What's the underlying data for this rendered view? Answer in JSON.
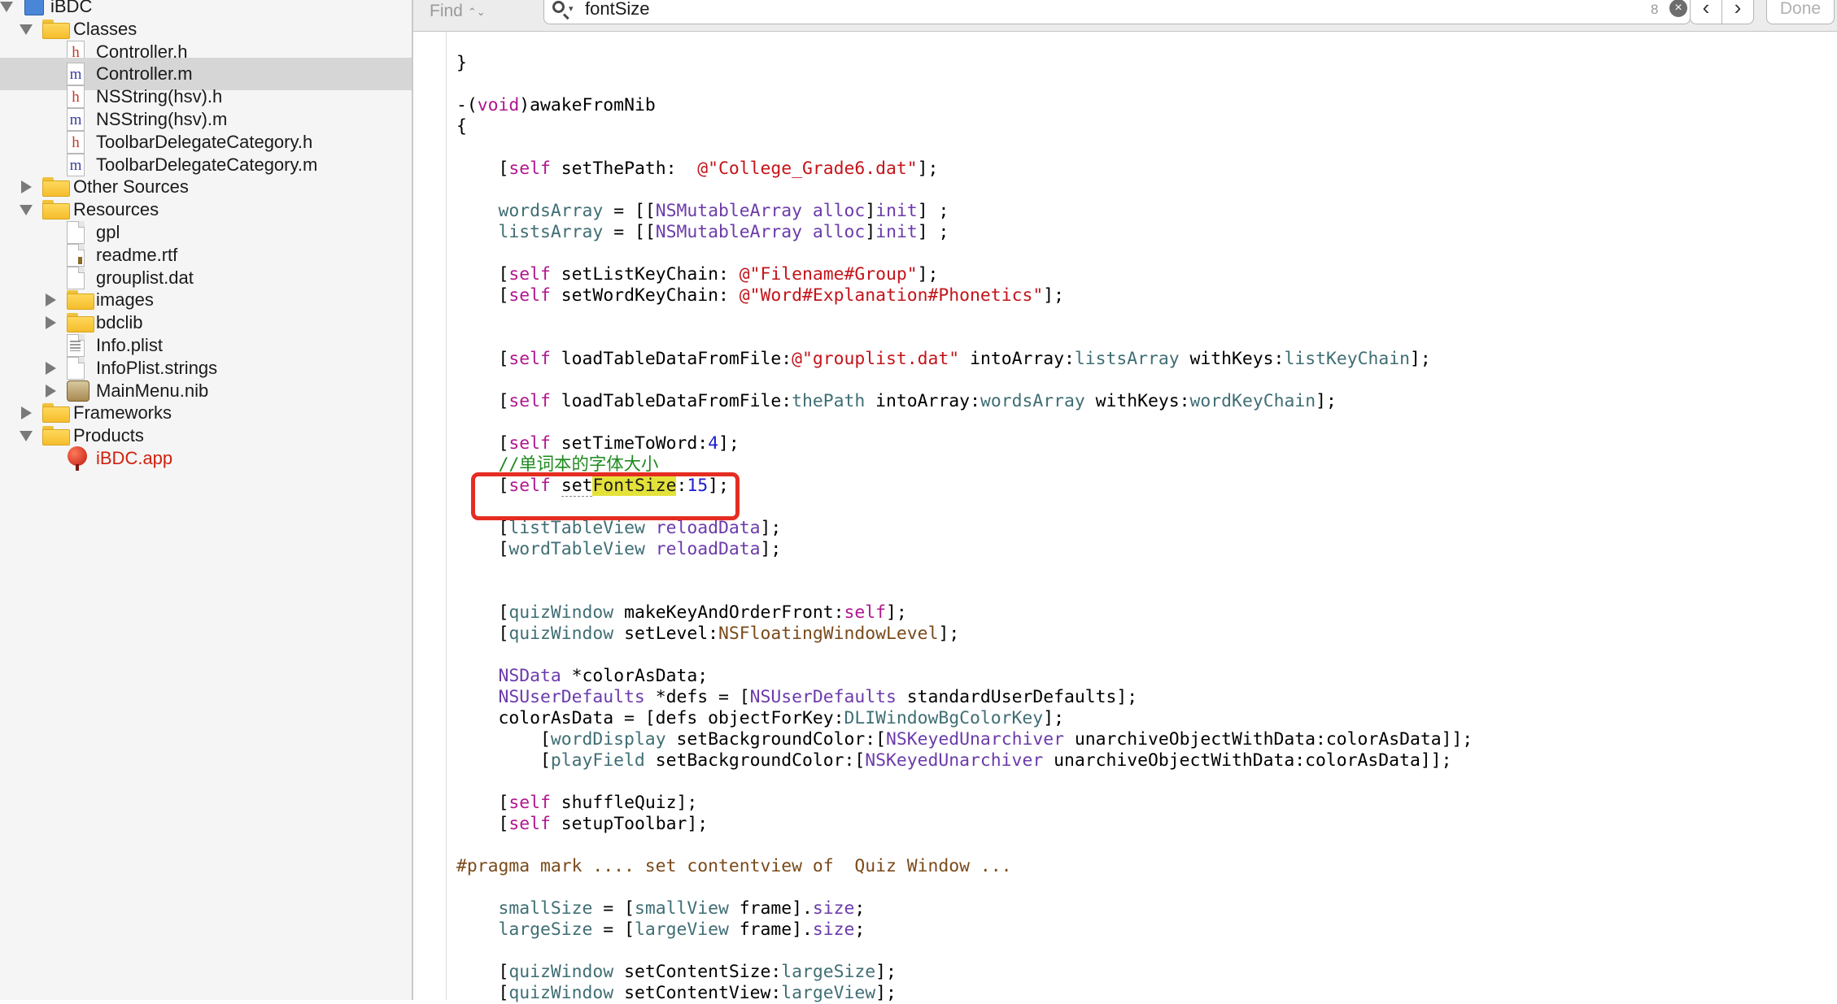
{
  "sidebar": {
    "items": [
      {
        "label": "iBDC",
        "kind": "project",
        "depth": 0,
        "disclosure": "open"
      },
      {
        "label": "Classes",
        "kind": "folder",
        "depth": 1,
        "disclosure": "open"
      },
      {
        "label": "Controller.h",
        "kind": "file-h",
        "depth": 2,
        "disclosure": "none"
      },
      {
        "label": "Controller.m",
        "kind": "file-m",
        "depth": 2,
        "disclosure": "none",
        "selected": true
      },
      {
        "label": "NSString(hsv).h",
        "kind": "file-h",
        "depth": 2,
        "disclosure": "none"
      },
      {
        "label": "NSString(hsv).m",
        "kind": "file-m",
        "depth": 2,
        "disclosure": "none"
      },
      {
        "label": "ToolbarDelegateCategory.h",
        "kind": "file-h",
        "depth": 2,
        "disclosure": "none"
      },
      {
        "label": "ToolbarDelegateCategory.m",
        "kind": "file-m",
        "depth": 2,
        "disclosure": "none"
      },
      {
        "label": "Other Sources",
        "kind": "folder",
        "depth": 1,
        "disclosure": "closed"
      },
      {
        "label": "Resources",
        "kind": "folder",
        "depth": 1,
        "disclosure": "open"
      },
      {
        "label": "gpl",
        "kind": "file-plain",
        "depth": 2,
        "disclosure": "none"
      },
      {
        "label": "readme.rtf",
        "kind": "file-rtf",
        "depth": 2,
        "disclosure": "none"
      },
      {
        "label": "grouplist.dat",
        "kind": "file-plain",
        "depth": 2,
        "disclosure": "none"
      },
      {
        "label": "images",
        "kind": "folder",
        "depth": 2,
        "disclosure": "closed"
      },
      {
        "label": "bdclib",
        "kind": "folder",
        "depth": 2,
        "disclosure": "closed"
      },
      {
        "label": "Info.plist",
        "kind": "file-plist",
        "depth": 2,
        "disclosure": "none"
      },
      {
        "label": "InfoPlist.strings",
        "kind": "file-plain",
        "depth": 2,
        "disclosure": "closed"
      },
      {
        "label": "MainMenu.nib",
        "kind": "nib",
        "depth": 2,
        "disclosure": "closed"
      },
      {
        "label": "Frameworks",
        "kind": "folder",
        "depth": 1,
        "disclosure": "closed"
      },
      {
        "label": "Products",
        "kind": "folder",
        "depth": 1,
        "disclosure": "open"
      },
      {
        "label": "iBDC.app",
        "kind": "app",
        "depth": 2,
        "disclosure": "none"
      }
    ]
  },
  "findbar": {
    "mode_label": "Find",
    "mode_arrows": "⌃⌄",
    "query": "fontSize",
    "match_count": "8",
    "clear_glyph": "×",
    "prev_glyph": "‹",
    "next_glyph": "›",
    "done_label": "Done"
  },
  "editor": {
    "file": "Controller.m",
    "highlight_color": "#e52d22",
    "find_match_color": "#e4e23a",
    "lines": [
      [
        {
          "t": "}"
        }
      ],
      [],
      [
        {
          "t": "-("
        },
        {
          "t": "void",
          "c": "kw"
        },
        {
          "t": ")awakeFromNib"
        }
      ],
      [
        {
          "t": "{"
        }
      ],
      [],
      [
        {
          "t": "    ["
        },
        {
          "t": "self",
          "c": "kw"
        },
        {
          "t": " setThePath:  "
        },
        {
          "t": "@\"College_Grade6.dat\"",
          "c": "str"
        },
        {
          "t": "];"
        }
      ],
      [],
      [
        {
          "t": "    "
        },
        {
          "t": "wordsArray",
          "c": "ivar"
        },
        {
          "t": " = [["
        },
        {
          "t": "NSMutableArray",
          "c": "cls"
        },
        {
          "t": " "
        },
        {
          "t": "alloc",
          "c": "cls"
        },
        {
          "t": "]"
        },
        {
          "t": "init",
          "c": "cls"
        },
        {
          "t": "] ;"
        }
      ],
      [
        {
          "t": "    "
        },
        {
          "t": "listsArray",
          "c": "ivar"
        },
        {
          "t": " = [["
        },
        {
          "t": "NSMutableArray",
          "c": "cls"
        },
        {
          "t": " "
        },
        {
          "t": "alloc",
          "c": "cls"
        },
        {
          "t": "]"
        },
        {
          "t": "init",
          "c": "cls"
        },
        {
          "t": "] ;"
        }
      ],
      [],
      [
        {
          "t": "    ["
        },
        {
          "t": "self",
          "c": "kw"
        },
        {
          "t": " setListKeyChain: "
        },
        {
          "t": "@\"Filename#Group\"",
          "c": "str"
        },
        {
          "t": "];"
        }
      ],
      [
        {
          "t": "    ["
        },
        {
          "t": "self",
          "c": "kw"
        },
        {
          "t": " setWordKeyChain: "
        },
        {
          "t": "@\"Word#Explanation#Phonetics\"",
          "c": "str"
        },
        {
          "t": "];"
        }
      ],
      [],
      [],
      [
        {
          "t": "    ["
        },
        {
          "t": "self",
          "c": "kw"
        },
        {
          "t": " loadTableDataFromFile:"
        },
        {
          "t": "@\"grouplist.dat\"",
          "c": "str"
        },
        {
          "t": " intoArray:"
        },
        {
          "t": "listsArray",
          "c": "ivar"
        },
        {
          "t": " withKeys:"
        },
        {
          "t": "listKeyChain",
          "c": "ivar"
        },
        {
          "t": "];"
        }
      ],
      [],
      [
        {
          "t": "    ["
        },
        {
          "t": "self",
          "c": "kw"
        },
        {
          "t": " loadTableDataFromFile:"
        },
        {
          "t": "thePath",
          "c": "ivar"
        },
        {
          "t": " intoArray:"
        },
        {
          "t": "wordsArray",
          "c": "ivar"
        },
        {
          "t": " withKeys:"
        },
        {
          "t": "wordKeyChain",
          "c": "ivar"
        },
        {
          "t": "];"
        }
      ],
      [],
      [
        {
          "t": "    ["
        },
        {
          "t": "self",
          "c": "kw"
        },
        {
          "t": " setTimeToWord:"
        },
        {
          "t": "4",
          "c": "num"
        },
        {
          "t": "];"
        }
      ],
      [
        {
          "t": "    "
        },
        {
          "t": "//单词本的字体大小",
          "c": "cmt"
        }
      ],
      [
        {
          "t": "    ["
        },
        {
          "t": "self",
          "c": "kw"
        },
        {
          "t": " "
        },
        {
          "t": "set",
          "c": "cursor-dash"
        },
        {
          "t": "FontSize",
          "c": "fmatch"
        },
        {
          "t": ":"
        },
        {
          "t": "15",
          "c": "num"
        },
        {
          "t": "];"
        }
      ],
      [],
      [
        {
          "t": "    ["
        },
        {
          "t": "listTableView",
          "c": "ivar"
        },
        {
          "t": " "
        },
        {
          "t": "reloadData",
          "c": "cls"
        },
        {
          "t": "];"
        }
      ],
      [
        {
          "t": "    ["
        },
        {
          "t": "wordTableView",
          "c": "ivar"
        },
        {
          "t": " "
        },
        {
          "t": "reloadData",
          "c": "cls"
        },
        {
          "t": "];"
        }
      ],
      [],
      [],
      [
        {
          "t": "    ["
        },
        {
          "t": "quizWindow",
          "c": "ivar"
        },
        {
          "t": " makeKeyAndOrderFront:"
        },
        {
          "t": "self",
          "c": "kw"
        },
        {
          "t": "];"
        }
      ],
      [
        {
          "t": "    ["
        },
        {
          "t": "quizWindow",
          "c": "ivar"
        },
        {
          "t": " setLevel:"
        },
        {
          "t": "NSFloatingWindowLevel",
          "c": "pre"
        },
        {
          "t": "];"
        }
      ],
      [],
      [
        {
          "t": "    "
        },
        {
          "t": "NSData",
          "c": "cls"
        },
        {
          "t": " *colorAsData;"
        }
      ],
      [
        {
          "t": "    "
        },
        {
          "t": "NSUserDefaults",
          "c": "cls"
        },
        {
          "t": " *defs = ["
        },
        {
          "t": "NSUserDefaults",
          "c": "cls"
        },
        {
          "t": " standardUserDefaults];"
        }
      ],
      [
        {
          "t": "    colorAsData = [defs objectForKey:"
        },
        {
          "t": "DLIWindowBgColorKey",
          "c": "ivar"
        },
        {
          "t": "];"
        }
      ],
      [
        {
          "t": "        ["
        },
        {
          "t": "wordDisplay",
          "c": "ivar"
        },
        {
          "t": " setBackgroundColor:["
        },
        {
          "t": "NSKeyedUnarchiver",
          "c": "cls"
        },
        {
          "t": " unarchiveObjectWithData:colorAsData]];"
        }
      ],
      [
        {
          "t": "        ["
        },
        {
          "t": "playField",
          "c": "ivar"
        },
        {
          "t": " setBackgroundColor:["
        },
        {
          "t": "NSKeyedUnarchiver",
          "c": "cls"
        },
        {
          "t": " unarchiveObjectWithData:colorAsData]];"
        }
      ],
      [],
      [
        {
          "t": "    ["
        },
        {
          "t": "self",
          "c": "kw"
        },
        {
          "t": " shuffleQuiz];"
        }
      ],
      [
        {
          "t": "    ["
        },
        {
          "t": "self",
          "c": "kw"
        },
        {
          "t": " setupToolbar];"
        }
      ],
      [],
      [
        {
          "t": "#pragma mark .... set contentview of  Quiz Window ...",
          "c": "pre"
        }
      ],
      [],
      [
        {
          "t": "    "
        },
        {
          "t": "smallSize",
          "c": "ivar"
        },
        {
          "t": " = ["
        },
        {
          "t": "smallView",
          "c": "ivar"
        },
        {
          "t": " frame]."
        },
        {
          "t": "size",
          "c": "cls"
        },
        {
          "t": ";"
        }
      ],
      [
        {
          "t": "    "
        },
        {
          "t": "largeSize",
          "c": "ivar"
        },
        {
          "t": " = ["
        },
        {
          "t": "largeView",
          "c": "ivar"
        },
        {
          "t": " frame]."
        },
        {
          "t": "size",
          "c": "cls"
        },
        {
          "t": ";"
        }
      ],
      [],
      [
        {
          "t": "    ["
        },
        {
          "t": "quizWindow",
          "c": "ivar"
        },
        {
          "t": " setContentSize:"
        },
        {
          "t": "largeSize",
          "c": "ivar"
        },
        {
          "t": "];"
        }
      ],
      [
        {
          "t": "    ["
        },
        {
          "t": "quizWindow",
          "c": "ivar"
        },
        {
          "t": " setContentView:"
        },
        {
          "t": "largeView",
          "c": "ivar"
        },
        {
          "t": "];"
        }
      ]
    ]
  }
}
